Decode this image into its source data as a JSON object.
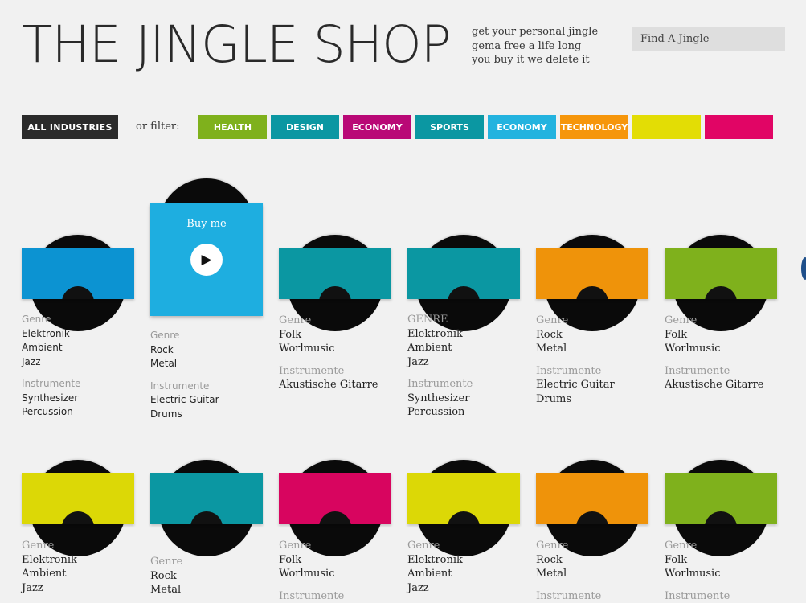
{
  "header": {
    "title": "THE JINGLE SHOP",
    "tagline": [
      "get your personal jingle",
      "gema free a life long",
      "you buy it we delete it"
    ],
    "search_placeholder": "Find A Jingle"
  },
  "filters": {
    "all_label": "ALL INDUSTRIES",
    "or_filter": "or filter:",
    "chips": [
      {
        "label": "HEALTH",
        "color": "#7fb11c"
      },
      {
        "label": "DESIGN",
        "color": "#0b97a2"
      },
      {
        "label": "ECONOMY",
        "color": "#b90876"
      },
      {
        "label": "SPORTS",
        "color": "#0b97a2"
      },
      {
        "label": "ECONOMY",
        "color": "#23b3df"
      },
      {
        "label": "TECHNOLOGY",
        "color": "#f6960b"
      },
      {
        "label": "",
        "color": "#e3dd05"
      },
      {
        "label": "",
        "color": "#e10565"
      }
    ]
  },
  "featured": {
    "buy_label": "Buy me",
    "play_icon": "play-icon"
  },
  "cards": [
    {
      "color": "#0c93d2",
      "genre_label": "Genre",
      "genre": [
        "Elektronik",
        "Ambient",
        "Jazz"
      ],
      "instr_label": "Instrumente",
      "instruments": [
        "Synthesizer",
        "Percussion"
      ]
    },
    {
      "color": "#1eaee0",
      "genre_label": "Genre",
      "genre": [
        "Rock",
        "Metal"
      ],
      "instr_label": "Instrumente",
      "instruments": [
        "Electric Guitar",
        "Drums"
      ]
    },
    {
      "color": "#0b97a2",
      "genre_label": "Genre",
      "genre": [
        "Folk",
        "Worlmusic"
      ],
      "instr_label": "Instrumente",
      "instruments": [
        "Akustische Gitarre"
      ]
    },
    {
      "color": "#0b97a2",
      "genre_label": "GENRE",
      "genre": [
        "Elektronik",
        "Ambient",
        "Jazz"
      ],
      "instr_label": "Instrumente",
      "instruments": [
        "Synthesizer",
        "Percussion"
      ]
    },
    {
      "color": "#ef930a",
      "genre_label": "Genre",
      "genre": [
        "Rock",
        "Metal"
      ],
      "instr_label": "Instrumente",
      "instruments": [
        "Electric Guitar",
        "Drums"
      ]
    },
    {
      "color": "#7fb11c",
      "genre_label": "Genre",
      "genre": [
        "Folk",
        "Worlmusic"
      ],
      "instr_label": "Instrumente",
      "instruments": [
        "Akustische Gitarre"
      ]
    },
    {
      "color": "#dcd806",
      "genre_label": "Genre",
      "genre": [
        "Elektronik",
        "Ambient",
        "Jazz"
      ]
    },
    {
      "color": "#0b97a2",
      "genre_label": "Genre",
      "genre": [
        "Rock",
        "Metal"
      ]
    },
    {
      "color": "#d8055f",
      "genre_label": "Genre",
      "genre": [
        "Folk",
        "Worlmusic"
      ],
      "instr_label": "Instrumente"
    },
    {
      "color": "#dcd806",
      "genre_label": "Genre",
      "genre": [
        "Elektronik",
        "Ambient",
        "Jazz"
      ]
    },
    {
      "color": "#ef930a",
      "genre_label": "Genre",
      "genre": [
        "Rock",
        "Metal"
      ],
      "instr_label": "Instrumente"
    },
    {
      "color": "#7fb11c",
      "genre_label": "Genre",
      "genre": [
        "Folk",
        "Worlmusic"
      ],
      "instr_label": "Instrumente"
    }
  ]
}
